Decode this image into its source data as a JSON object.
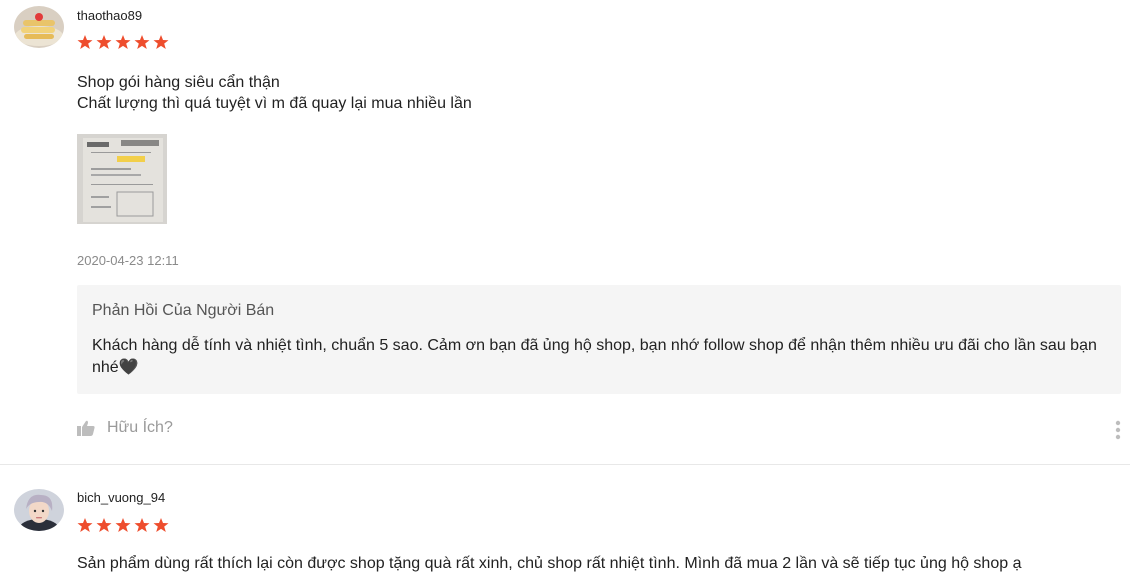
{
  "reviews": [
    {
      "username": "thaothao89",
      "rating": 5,
      "comment_lines": [
        "Shop gói hàng siêu cẩn thận",
        "Chất lượng thì quá tuyệt vì m đã quay lại mua nhiều lần"
      ],
      "timestamp": "2020-04-23 12:11",
      "seller_reply": {
        "title": "Phản Hồi Của Người Bán",
        "text": "Khách hàng dễ tính và nhiệt tình, chuẩn 5 sao. Cảm ơn bạn đã ủng hộ shop, bạn nhớ follow shop để nhận thêm nhiều ưu đãi cho lần sau bạn nhé🖤"
      },
      "helpful_label": "Hữu Ích?"
    },
    {
      "username": "bich_vuong_94",
      "rating": 5,
      "comment": "Sản phẩm dùng rất thích lại còn được shop tặng quà rất xinh, chủ shop rất nhiệt tình. Mình đã mua 2 lần và sẽ tiếp tục ủng hộ shop ạ"
    }
  ],
  "colors": {
    "star": "#ee4d2d",
    "reply_bg": "#f5f5f5",
    "timestamp": "#8a8a8a"
  },
  "icons": {
    "star": "star-icon",
    "like": "thumbs-up-icon",
    "more": "more-vertical-icon"
  }
}
